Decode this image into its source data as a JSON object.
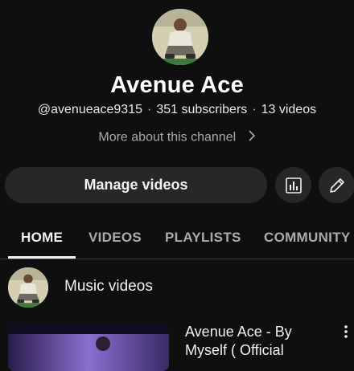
{
  "channel": {
    "name": "Avenue Ace",
    "handle": "@avenueace9315",
    "subscribers": "351 subscribers",
    "videos_count": "13 videos",
    "more_about": "More about this channel"
  },
  "actions": {
    "manage_videos": "Manage videos",
    "analytics_icon": "bar-chart-icon",
    "edit_icon": "pencil-icon"
  },
  "tabs": [
    {
      "label": "HOME",
      "active": true
    },
    {
      "label": "VIDEOS",
      "active": false
    },
    {
      "label": "PLAYLISTS",
      "active": false
    },
    {
      "label": "COMMUNITY",
      "active": false
    }
  ],
  "section": {
    "title": "Music videos",
    "video": {
      "title": "Avenue Ace - By Myself  ( Official"
    }
  },
  "colors": {
    "background": "#0f0f0f",
    "button_bg": "#272727",
    "text_primary": "#f1f1f1",
    "text_secondary": "#aaaaaa"
  }
}
